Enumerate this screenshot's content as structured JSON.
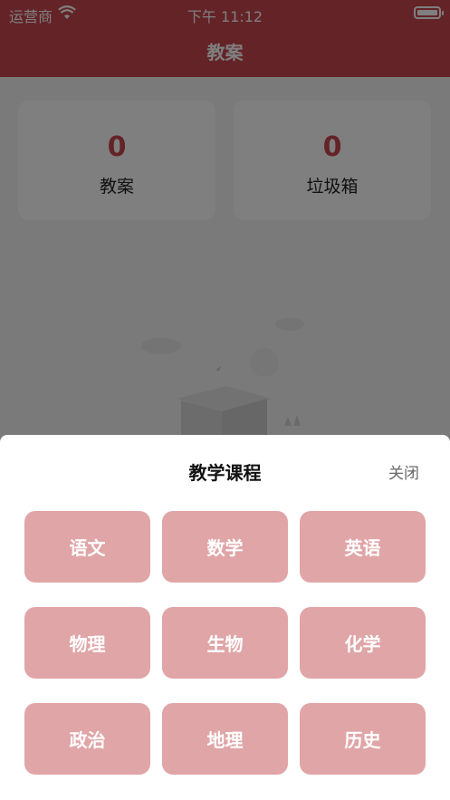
{
  "status_bar": {
    "carrier": "运营商",
    "time": "下午 11:12"
  },
  "header": {
    "title": "教案"
  },
  "cards": [
    {
      "count": "0",
      "label": "教案"
    },
    {
      "count": "0",
      "label": "垃圾箱"
    }
  ],
  "sheet": {
    "title": "教学课程",
    "close_label": "关闭",
    "courses": [
      "语文",
      "数学",
      "英语",
      "物理",
      "生物",
      "化学",
      "政治",
      "地理",
      "历史"
    ]
  },
  "colors": {
    "accent": "#c9474e",
    "course_button": "#e0a5a7",
    "overlay": "rgba(0,0,0,0.5)"
  }
}
